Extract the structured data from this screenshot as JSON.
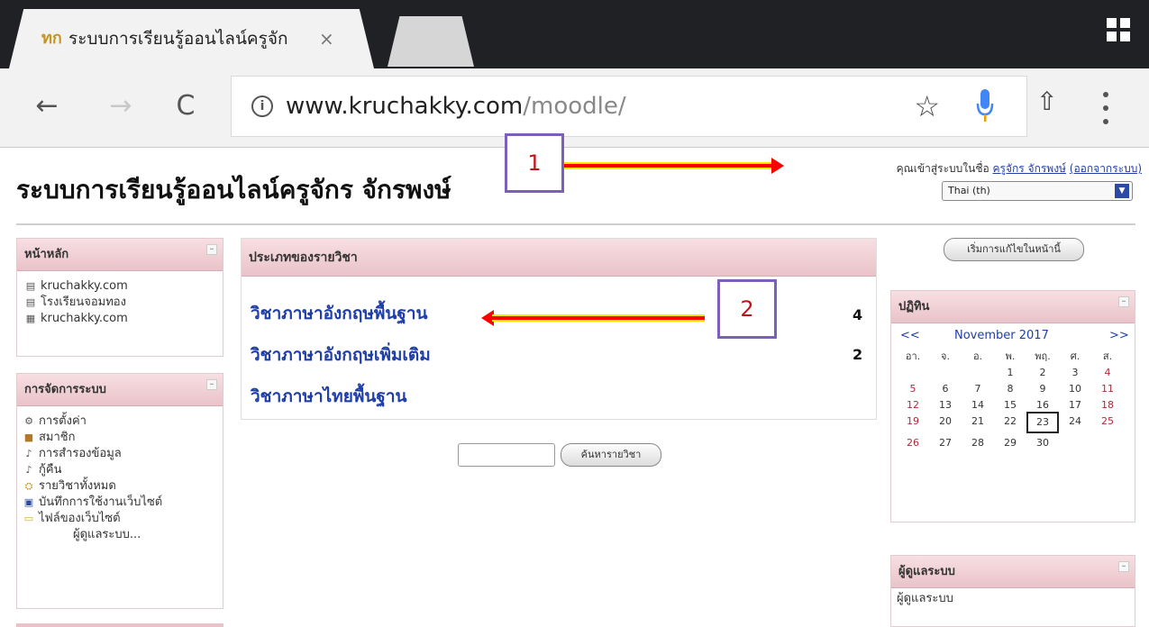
{
  "browser": {
    "tab_title": "ระบบการเรียนรู้ออนไลน์ครูจัก",
    "tab_favicon": "ทก",
    "tab_close": "×",
    "url_host": "www.kruchakky.com",
    "url_path": "/moodle/",
    "icons": {
      "apps": "apps-grid-icon",
      "back": "←",
      "forward": "→",
      "reload": "C",
      "info": "i",
      "star": "☆",
      "share": "⇧"
    }
  },
  "page": {
    "site_title": "ระบบการเรียนรู้ออนไลน์ครูจักร จักรพงษ์",
    "login_prefix": "คุณเข้าสู่ระบบในชื่อ ",
    "login_user": "ครูจักร จักรพงษ์",
    "logout": "(ออกจากระบบ)",
    "language": "Thai (th)"
  },
  "callouts": [
    "1",
    "2"
  ],
  "main_menu": {
    "title": "หน้าหลัก",
    "items": [
      "kruchakky.com",
      "โรงเรียนจอมทอง",
      "kruchakky.com"
    ]
  },
  "admin_menu": {
    "title": "การจัดการระบบ",
    "items": [
      "การตั้งค่า",
      "สมาชิก",
      "การสำรองข้อมูล",
      "กู้คืน",
      "รายวิชาทั้งหมด",
      "บันทึกการใช้งานเว็บไซต์",
      "ไฟล์ของเว็บไซต์"
    ],
    "more": "ผู้ดูแลระบบ..."
  },
  "categories": {
    "title": "ประเภทของรายวิชา",
    "rows": [
      {
        "name": "วิชาภาษาอังกฤษพื้นฐาน",
        "count": "4"
      },
      {
        "name": "วิชาภาษาอังกฤษเพิ่มเติม",
        "count": "2"
      },
      {
        "name": "วิชาภาษาไทยพื้นฐาน",
        "count": ""
      }
    ]
  },
  "search": {
    "button": "ค้นหารายวิชา"
  },
  "turn_edit": "เริ่มการแก้ไขในหน้านี้",
  "calendar": {
    "title": "ปฏิทิน",
    "prev": "<<",
    "month": "November 2017",
    "next": ">>",
    "weekdays": [
      "อา.",
      "จ.",
      "อ.",
      "พ.",
      "พฤ.",
      "ศ.",
      "ส."
    ],
    "weeks": [
      [
        "",
        "",
        "",
        "1",
        "2",
        "3",
        "4"
      ],
      [
        "5",
        "6",
        "7",
        "8",
        "9",
        "10",
        "11"
      ],
      [
        "12",
        "13",
        "14",
        "15",
        "16",
        "17",
        "18"
      ],
      [
        "19",
        "20",
        "21",
        "22",
        "23",
        "24",
        "25"
      ],
      [
        "26",
        "27",
        "28",
        "29",
        "30",
        "",
        ""
      ]
    ],
    "today": "23"
  },
  "admins_block": {
    "title": "ผู้ดูแลระบบ",
    "item": "ผู้ดูแลระบบ"
  },
  "colors": {
    "accent_link": "#1f3ea8",
    "block_header": "#e9c3c9",
    "arrow": "#ff0000",
    "callout_border": "#7c5fb8",
    "callout_text": "#c0141b"
  }
}
